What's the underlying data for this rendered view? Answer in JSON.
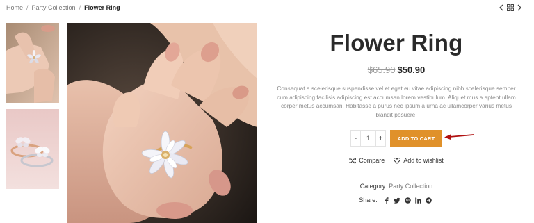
{
  "breadcrumb": {
    "items": [
      "Home",
      "Party Collection"
    ],
    "separator": "/",
    "current": "Flower Ring"
  },
  "product_nav": {
    "prev_icon": "chevron-left-icon",
    "grid_icon": "grid-icon",
    "next_icon": "chevron-right-icon"
  },
  "gallery": {
    "thumbnails": [
      "ring-on-hand-thumbnail",
      "two-butterfly-rings-thumbnail"
    ],
    "main": "ring-on-hand-photo"
  },
  "product": {
    "title": "Flower Ring",
    "old_price": "$65.90",
    "price": "$50.90",
    "description": "Consequat a scelerisque suspendisse vel et eget eu vitae adipiscing nibh scelerisque semper cum adipiscing facilisis adipiscing est accumsan lorem vestibulum. Aliquet mus a aptent ullam corper metus accumsan. Habitasse a purus nec ipsum a urna ac ullamcorper varius metus blandit posuere.",
    "quantity": "1",
    "qty_minus": "-",
    "qty_plus": "+",
    "add_to_cart": "ADD TO CART",
    "compare": "Compare",
    "wishlist": "Add to wishlist",
    "category_label": "Category:",
    "category": "Party Collection",
    "share_label": "Share:",
    "share_icons": [
      "facebook-icon",
      "twitter-icon",
      "pinterest-icon",
      "linkedin-icon",
      "telegram-icon"
    ]
  },
  "colors": {
    "accent": "#e0912a",
    "arrow": "#b01111",
    "title": "#2a2a2a",
    "muted_text": "#8a8a8a"
  }
}
